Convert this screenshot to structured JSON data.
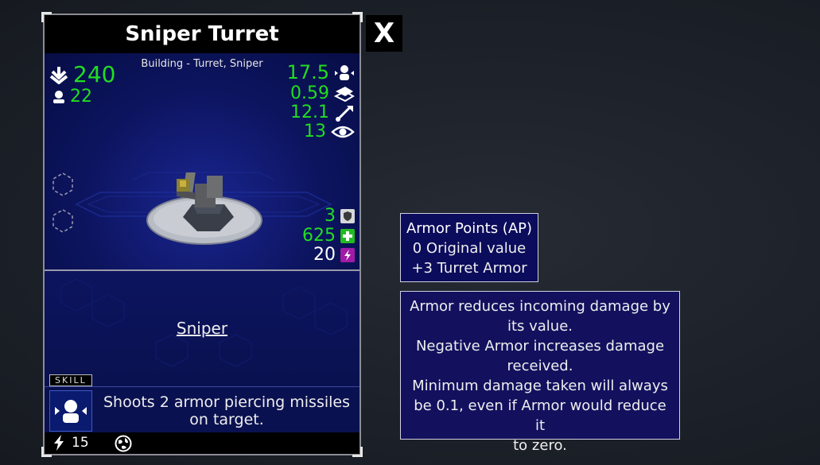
{
  "card": {
    "title": "Sniper Turret",
    "subtitle": "Building - Turret, Sniper",
    "left_stats": {
      "resource": {
        "icon": "supply-arrow-icon",
        "value": "240"
      },
      "population": {
        "icon": "pawn-icon",
        "value": "22"
      }
    },
    "right_stats": [
      {
        "icon": "attack-damage-icon",
        "value": "17.5"
      },
      {
        "icon": "attack-speed-icon",
        "value": "0.59"
      },
      {
        "icon": "range-icon",
        "value": "12.1"
      },
      {
        "icon": "eye-icon",
        "value": "13"
      }
    ],
    "defense_stats": [
      {
        "icon": "armor-shield-icon",
        "value": "3",
        "color": "#22dd22",
        "icon_bg": "#d8d8d8"
      },
      {
        "icon": "health-cross-icon",
        "value": "625",
        "color": "#22dd22",
        "icon_bg": "#22bb22"
      },
      {
        "icon": "energy-bolt-icon",
        "value": "20",
        "color": "#ffffff",
        "icon_bg": "#a01aa8"
      }
    ],
    "skill": {
      "name": "Sniper",
      "tag": "SKILL",
      "description": "Shoots 2 armor piercing missiles on target."
    },
    "footer": {
      "energy_cost": "15"
    }
  },
  "close_button": {
    "label": "X"
  },
  "armor_tooltip": {
    "title": "Armor Points (AP)",
    "lines": [
      "0 Original value",
      "+3 Turret Armor"
    ]
  },
  "armor_description": {
    "lines": [
      "Armor reduces incoming damage by",
      "its value.",
      "Negative Armor increases damage",
      "received.",
      "Minimum damage taken will always",
      "be 0.1, even if Armor would reduce it",
      "to zero."
    ]
  },
  "colors": {
    "accent_green": "#22dd22",
    "card_blue": "#0b1258",
    "energy_purple": "#a01aa8"
  }
}
